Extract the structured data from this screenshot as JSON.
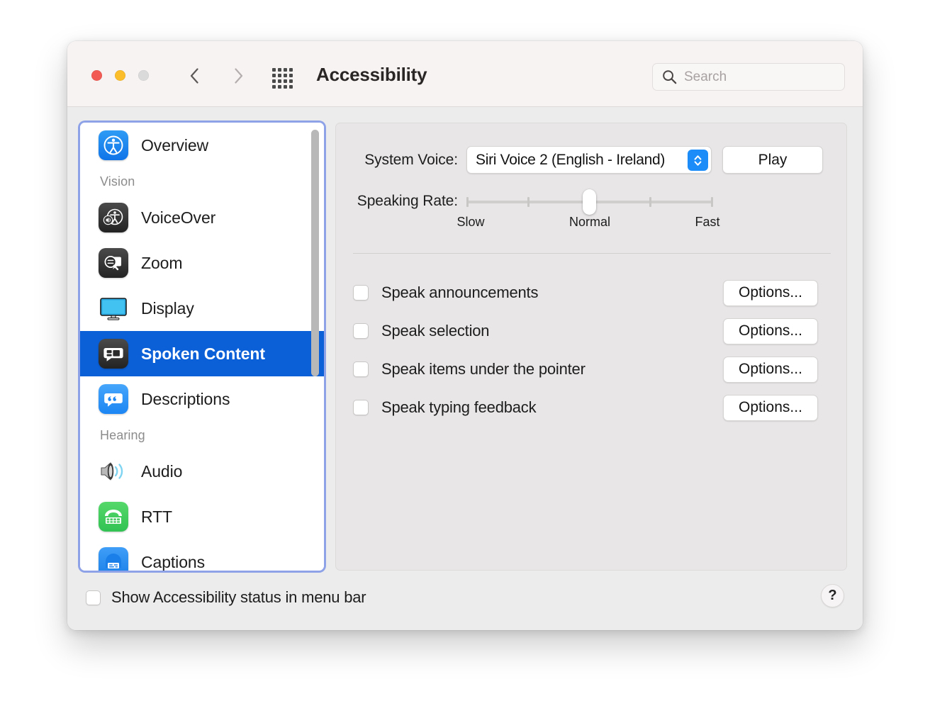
{
  "window": {
    "title": "Accessibility",
    "traffic_lights": [
      "close",
      "minimize",
      "zoom"
    ],
    "nav": {
      "back": "back-arrow",
      "forward": "forward-arrow"
    },
    "grid_button": "show-all-icon"
  },
  "search": {
    "placeholder": "Search",
    "value": "",
    "icon": "search-icon"
  },
  "sidebar": {
    "items": [
      {
        "label": "Overview",
        "icon": "accessibility-icon",
        "type": "item",
        "selected": false
      },
      {
        "label": "Vision",
        "icon": "",
        "type": "group"
      },
      {
        "label": "VoiceOver",
        "icon": "voiceover-icon",
        "type": "item",
        "selected": false
      },
      {
        "label": "Zoom",
        "icon": "zoom-magnifier-icon",
        "type": "item",
        "selected": false
      },
      {
        "label": "Display",
        "icon": "display-monitor-icon",
        "type": "item",
        "selected": false
      },
      {
        "label": "Spoken Content",
        "icon": "speech-bubble-icon",
        "type": "item",
        "selected": true
      },
      {
        "label": "Descriptions",
        "icon": "quotes-bubble-icon",
        "type": "item",
        "selected": false
      },
      {
        "label": "Hearing",
        "icon": "",
        "type": "group"
      },
      {
        "label": "Audio",
        "icon": "speaker-icon",
        "type": "item",
        "selected": false
      },
      {
        "label": "RTT",
        "icon": "telephone-icon",
        "type": "item",
        "selected": false
      },
      {
        "label": "Captions",
        "icon": "captions-icon",
        "type": "item",
        "selected": false
      }
    ]
  },
  "main": {
    "system_voice": {
      "label": "System Voice:",
      "selected_option": "Siri Voice 2 (English - Ireland)",
      "play_button": "Play",
      "stepper_icon": "up-down-chevron-icon"
    },
    "speaking_rate": {
      "label": "Speaking Rate:",
      "tick_labels": [
        "Slow",
        "Normal",
        "Fast"
      ],
      "tick_positions_pct": [
        0,
        50,
        100
      ],
      "ticks_pct": [
        0,
        25,
        50,
        75,
        100
      ],
      "value_pct": 50
    },
    "checkboxes": [
      {
        "label": "Speak announcements",
        "checked": false,
        "options_label": "Options..."
      },
      {
        "label": "Speak selection",
        "checked": false,
        "options_label": "Options..."
      },
      {
        "label": "Speak items under the pointer",
        "checked": false,
        "options_label": "Options..."
      },
      {
        "label": "Speak typing feedback",
        "checked": false,
        "options_label": "Options..."
      }
    ]
  },
  "footer": {
    "status_checkbox": {
      "label": "Show Accessibility status in menu bar",
      "checked": false
    },
    "help_button": "?"
  },
  "colors": {
    "accent_blue": "#0b60d8",
    "stepper_blue": "#1c8cf8",
    "focus_ring": "#8ea2e8",
    "titlebar_bg": "#f7f3f3",
    "window_bg": "#ececec",
    "panel_bg": "#e8e6e6",
    "sidebar_bg": "#ffffff"
  }
}
